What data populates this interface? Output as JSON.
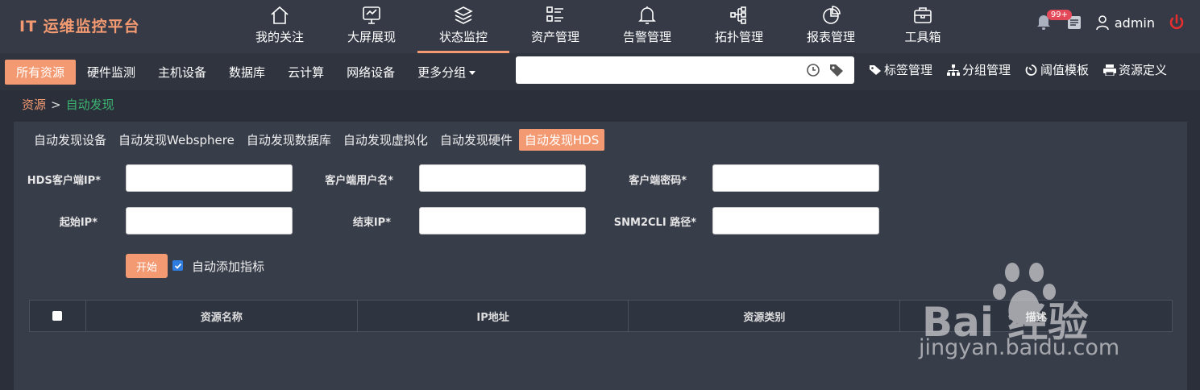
{
  "app": {
    "title": "IT 运维监控平台"
  },
  "nav": [
    {
      "label": "我的关注",
      "icon": "home-icon"
    },
    {
      "label": "大屏展现",
      "icon": "monitor-icon"
    },
    {
      "label": "状态监控",
      "icon": "layers-icon",
      "active": true
    },
    {
      "label": "资产管理",
      "icon": "list-icon"
    },
    {
      "label": "告警管理",
      "icon": "bell-icon"
    },
    {
      "label": "拓扑管理",
      "icon": "topology-icon"
    },
    {
      "label": "报表管理",
      "icon": "pie-chart-icon"
    },
    {
      "label": "工具箱",
      "icon": "toolbox-icon"
    }
  ],
  "user": {
    "badge": "99+",
    "name": "admin"
  },
  "subnav": {
    "tabs": [
      "所有资源",
      "硬件监测",
      "主机设备",
      "数据库",
      "云计算",
      "网络设备",
      "更多分组"
    ],
    "search_placeholder": "",
    "tools": [
      "标签管理",
      "分组管理",
      "阈值模板",
      "资源定义"
    ]
  },
  "breadcrumb": {
    "root": "资源",
    "separator": ">",
    "current": "自动发现"
  },
  "panel": {
    "tabs": [
      "自动发现设备",
      "自动发现Websphere",
      "自动发现数据库",
      "自动发现虚拟化",
      "自动发现硬件",
      "自动发现HDS"
    ],
    "form": {
      "hds_ip_label": "HDS客户端IP*",
      "client_user_label": "客户端用户名*",
      "client_pwd_label": "客户端密码*",
      "start_ip_label": "起始IP*",
      "end_ip_label": "结束IP*",
      "snm2cli_label": "SNM2CLI 路径*"
    },
    "start_button": "开始",
    "auto_add_label": "自动添加指标",
    "table": {
      "columns": [
        "资源名称",
        "IP地址",
        "资源类别",
        "描述"
      ]
    }
  },
  "watermark": {
    "brand": "Bai 经验",
    "url": "jingyan.baidu.com"
  },
  "colors": {
    "accent": "#f39a72",
    "current": "#3cb371",
    "alert": "#e4495a",
    "power": "#e62e2e"
  }
}
